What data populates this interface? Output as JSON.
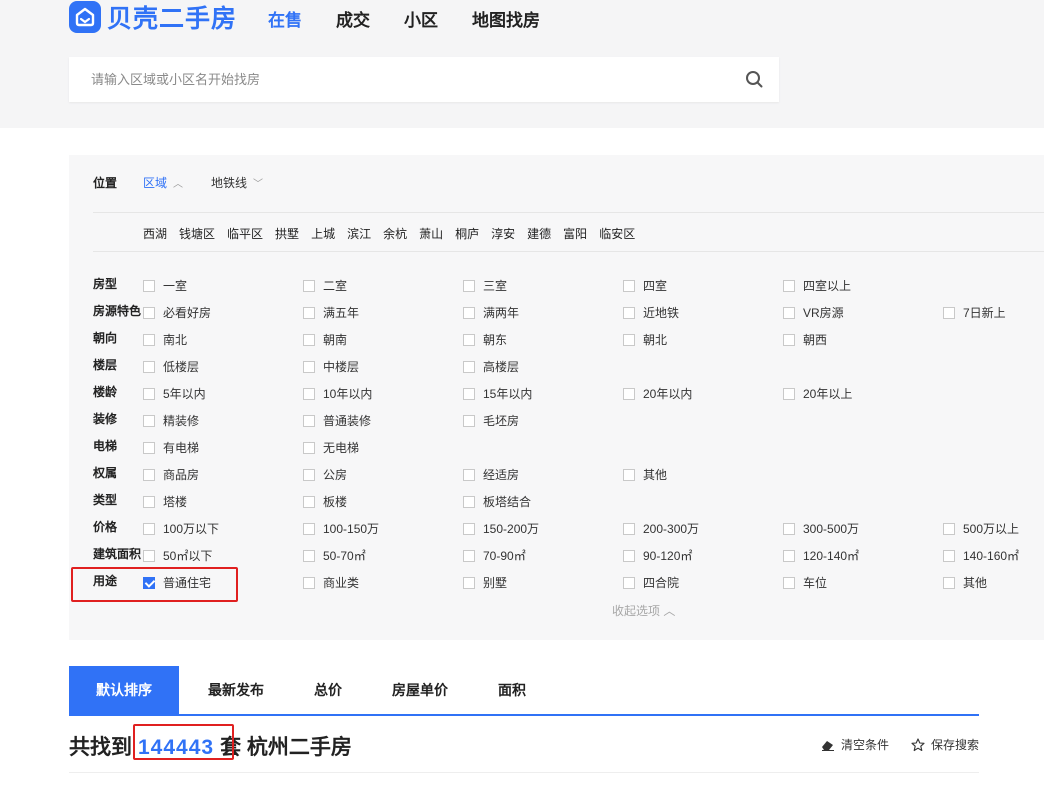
{
  "brand": {
    "name": "贝壳二手房",
    "color": "#3072f6"
  },
  "nav": [
    "在售",
    "成交",
    "小区",
    "地图找房"
  ],
  "search": {
    "placeholder": "请输入区域或小区名开始找房",
    "icon": "search-icon"
  },
  "location": {
    "label": "位置",
    "tabs": [
      "区域",
      "地铁线"
    ],
    "districts": [
      "西湖",
      "钱塘区",
      "临平区",
      "拱墅",
      "上城",
      "滨江",
      "余杭",
      "萧山",
      "桐庐",
      "淳安",
      "建德",
      "富阳",
      "临安区"
    ]
  },
  "filters": [
    {
      "label": "房型",
      "options": [
        "一室",
        "二室",
        "三室",
        "四室",
        "四室以上"
      ]
    },
    {
      "label": "房源特色",
      "options": [
        "必看好房",
        "满五年",
        "满两年",
        "近地铁",
        "VR房源",
        "7日新上"
      ]
    },
    {
      "label": "朝向",
      "options": [
        "南北",
        "朝南",
        "朝东",
        "朝北",
        "朝西"
      ]
    },
    {
      "label": "楼层",
      "options": [
        "低楼层",
        "中楼层",
        "高楼层"
      ]
    },
    {
      "label": "楼龄",
      "options": [
        "5年以内",
        "10年以内",
        "15年以内",
        "20年以内",
        "20年以上"
      ]
    },
    {
      "label": "装修",
      "options": [
        "精装修",
        "普通装修",
        "毛坯房"
      ]
    },
    {
      "label": "电梯",
      "options": [
        "有电梯",
        "无电梯"
      ]
    },
    {
      "label": "权属",
      "options": [
        "商品房",
        "公房",
        "经适房",
        "其他"
      ]
    },
    {
      "label": "类型",
      "options": [
        "塔楼",
        "板楼",
        "板塔结合"
      ]
    },
    {
      "label": "价格",
      "options": [
        "100万以下",
        "100-150万",
        "150-200万",
        "200-300万",
        "300-500万",
        "500万以上"
      ]
    },
    {
      "label": "建筑面积",
      "options": [
        "50㎡以下",
        "50-70㎡",
        "70-90㎡",
        "90-120㎡",
        "120-140㎡",
        "140-160㎡"
      ]
    },
    {
      "label": "用途",
      "options": [
        "普通住宅",
        "商业类",
        "别墅",
        "四合院",
        "车位",
        "其他"
      ],
      "checked": [
        0
      ]
    }
  ],
  "collapse_label": "收起选项",
  "sort_tabs": [
    "默认排序",
    "最新发布",
    "总价",
    "房屋单价",
    "面积"
  ],
  "result": {
    "prefix": "共找到",
    "count": "144443",
    "suffix": "套 杭州二手房"
  },
  "actions": {
    "clear": "清空条件",
    "save": "保存搜索"
  }
}
